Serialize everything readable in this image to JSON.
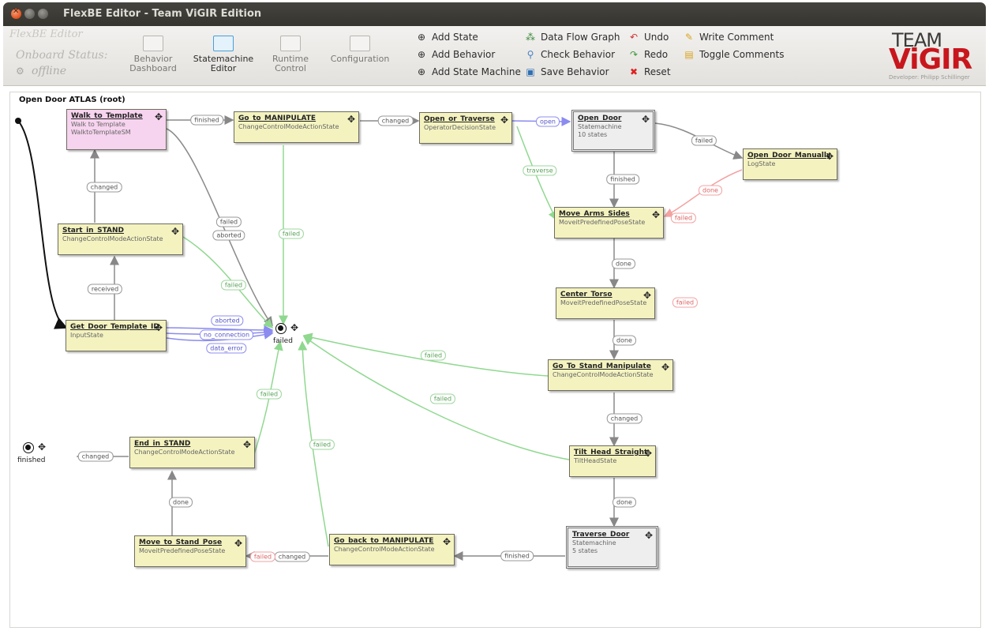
{
  "window": {
    "title": "FlexBE Editor - Team ViGIR Edition"
  },
  "status": {
    "app_name": "FlexBE Editor",
    "label": "Onboard Status:",
    "value": "offline"
  },
  "tabs": [
    {
      "label_1": "Behavior",
      "label_2": "Dashboard"
    },
    {
      "label_1": "Statemachine",
      "label_2": "Editor"
    },
    {
      "label_1": "Runtime",
      "label_2": "Control"
    },
    {
      "label_1": "Configuration",
      "label_2": ""
    }
  ],
  "actions": {
    "add_state": "Add State",
    "add_behavior": "Add Behavior",
    "add_state_machine": "Add State Machine",
    "data_flow_graph": "Data Flow Graph",
    "check_behavior": "Check Behavior",
    "save_behavior": "Save Behavior",
    "undo": "Undo",
    "redo": "Redo",
    "reset": "Reset",
    "write_comment": "Write Comment",
    "toggle_comments": "Toggle Comments"
  },
  "logo": {
    "team": "TEAM",
    "vigir": "ViGIR",
    "developer": "Developer: Philipp Schillinger"
  },
  "canvas": {
    "root_label": "Open Door ATLAS (root)"
  },
  "states": {
    "walk": {
      "name": "Walk_to_Template",
      "line1": "Walk to Template",
      "line2": "WalktoTemplateSM"
    },
    "gotomanip": {
      "name": "Go_to_MANIPULATE",
      "line1": "ChangeControlModeActionState"
    },
    "opentraverse": {
      "name": "Open_or_Traverse",
      "line1": "OperatorDecisionState"
    },
    "opendoor": {
      "name": "Open_Door",
      "line1": "Statemachine",
      "line2": "10 states"
    },
    "manual": {
      "name": "Open_Door_Manually",
      "line1": "LogState"
    },
    "movearms": {
      "name": "Move_Arms_Sides",
      "line1": "MoveitPredefinedPoseState"
    },
    "startstand": {
      "name": "Start_in_STAND",
      "line1": "ChangeControlModeActionState"
    },
    "getdoor": {
      "name": "Get_Door_Template_ID",
      "line1": "InputState"
    },
    "centertorso": {
      "name": "Center_Torso",
      "line1": "MoveitPredefinedPoseState"
    },
    "gotostand": {
      "name": "Go_To_Stand_Manipulate",
      "line1": "ChangeControlModeActionState"
    },
    "tilthead": {
      "name": "Tilt_Head_Straight",
      "line1": "TiltHeadState"
    },
    "endstand": {
      "name": "End_in_STAND",
      "line1": "ChangeControlModeActionState"
    },
    "traverse": {
      "name": "Traverse_Door",
      "line1": "Statemachine",
      "line2": "5 states"
    },
    "movestand": {
      "name": "Move_to_Stand_Pose",
      "line1": "MoveitPredefinedPoseState"
    },
    "goback": {
      "name": "Go_back_to_MANIPULATE",
      "line1": "ChangeControlModeActionState"
    }
  },
  "outcomes": {
    "failed": "failed",
    "finished": "finished"
  },
  "edge_labels": {
    "walk_finished": "finished",
    "gotomanip_changed": "changed",
    "open": "open",
    "traverse": "traverse",
    "opendoor_failed": "failed",
    "opendoor_finished": "finished",
    "manual_done": "done",
    "movearms_failed": "failed",
    "start_changed": "changed",
    "walk_failed": "failed",
    "walk_aborted": "aborted",
    "gotomanip_failed": "failed",
    "start_failed": "failed",
    "received": "received",
    "get_aborted": "aborted",
    "no_connection": "no_connection",
    "data_error": "data_error",
    "movearms_done": "done",
    "center_failed": "failed",
    "center_done": "done",
    "gotostand_failed": "failed",
    "gotostand_changed": "changed",
    "tilt_failed": "failed",
    "tilt_done": "done",
    "endstand_failed": "failed",
    "endstand_changed": "changed",
    "goback_failed": "failed",
    "movestand_done": "done",
    "traverse_finished": "finished",
    "goback_changed": "changed",
    "movestand_failed": "failed"
  }
}
